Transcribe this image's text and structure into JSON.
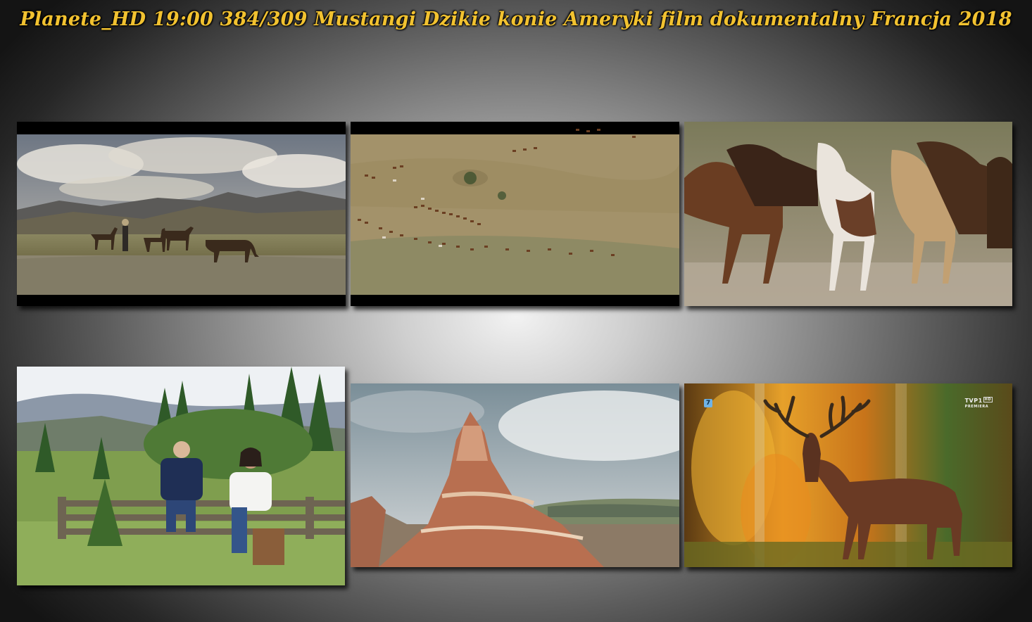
{
  "title": "Planete_HD 19:00 384/309 Mustangi Dzikie konie Ameryki film dokumentalny Francja 2018",
  "colors": {
    "title": "#f2c230",
    "background_center": "#f2f2f2",
    "background_edge": "#141414"
  },
  "frames": [
    {
      "scene": "horses-drinking-at-pond"
    },
    {
      "scene": "aerial-herd-on-plain"
    },
    {
      "scene": "running-horses-closeup"
    },
    {
      "scene": "two-presenters-on-fence"
    },
    {
      "scene": "red-rock-butte"
    },
    {
      "scene": "red-deer-stag-autumn"
    }
  ],
  "overlay": {
    "channel_number": "7",
    "channel_logo": "TVP1",
    "channel_logo_hd": "HD",
    "channel_logo_sub": "PREMIERA"
  }
}
